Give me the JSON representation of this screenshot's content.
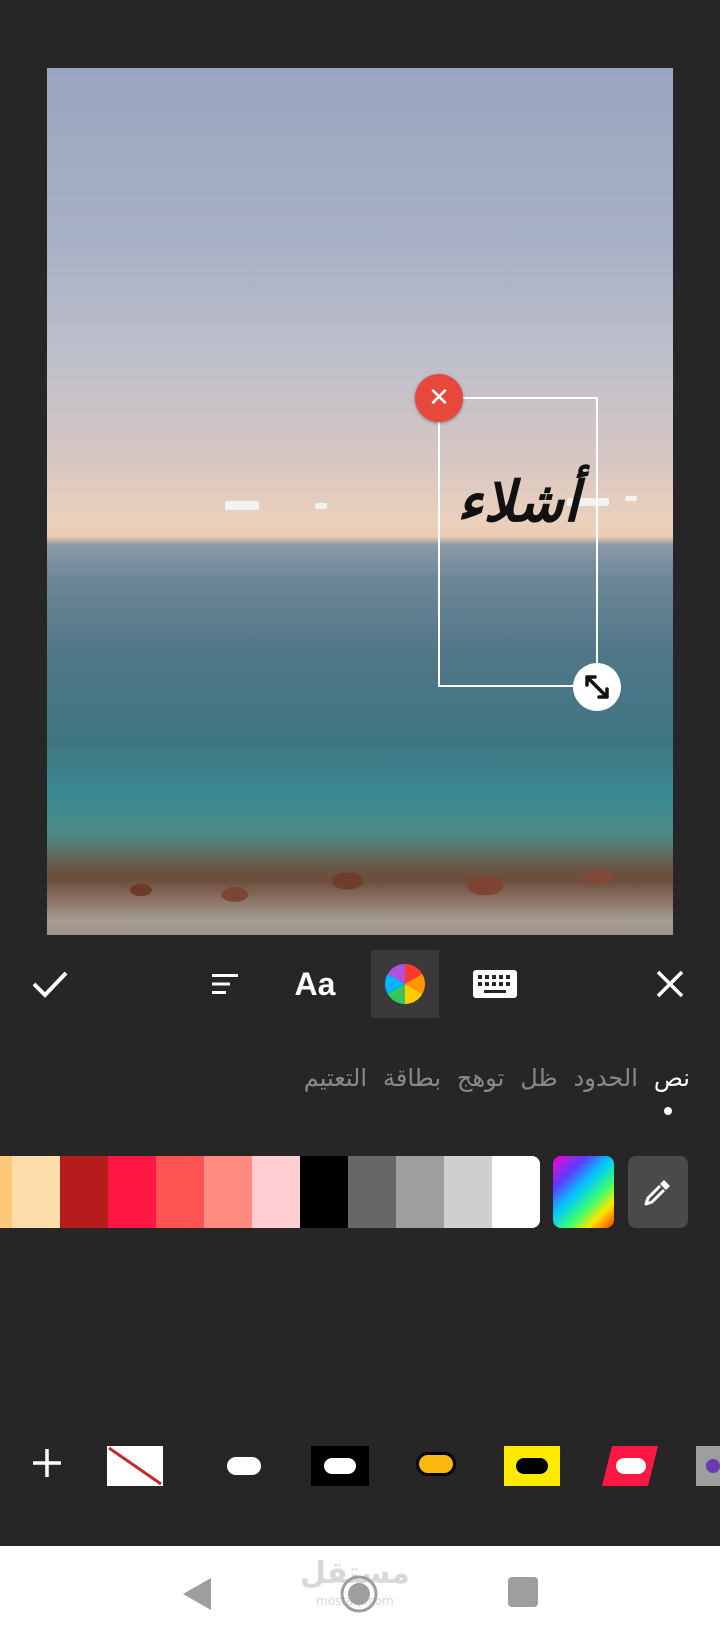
{
  "canvas": {
    "text_overlay": "أشلاء"
  },
  "toolbar": {
    "confirm_icon": "check-icon",
    "align_icon": "align-left-icon",
    "font_label": "Aa",
    "color_icon": "color-wheel-icon",
    "keyboard_icon": "keyboard-icon",
    "close_icon": "close-icon"
  },
  "subtabs": [
    {
      "label": "نص",
      "selected": true
    },
    {
      "label": "الحدود",
      "selected": false
    },
    {
      "label": "ظل",
      "selected": false
    },
    {
      "label": "توهج",
      "selected": false
    },
    {
      "label": "بطاقة",
      "selected": false
    },
    {
      "label": "التعتيم",
      "selected": false
    }
  ],
  "colors": [
    "#fcc97a",
    "#ffdeab",
    "#b71c1c",
    "#ff1744",
    "#ff5252",
    "#ff8a80",
    "#ffcdd2",
    "#000000",
    "#666666",
    "#9e9e9e",
    "#cfcfcf",
    "#ffffff"
  ],
  "background_styles": [
    {
      "name": "add",
      "icon": "plus-icon"
    },
    {
      "name": "none"
    },
    {
      "name": "white-pill"
    },
    {
      "name": "black-box-white-pill"
    },
    {
      "name": "yellow-pill"
    },
    {
      "name": "yellow-box-black-pill"
    },
    {
      "name": "red-parallelogram"
    },
    {
      "name": "gray-partial"
    }
  ],
  "watermark": {
    "text": "مستقل",
    "sub": "mostaql.com"
  },
  "accent": "#e8483c"
}
